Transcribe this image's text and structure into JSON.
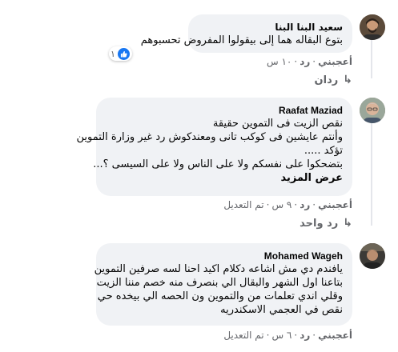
{
  "comments": [
    {
      "author": "سعيد البنا البنا",
      "lines": [
        "بتوع البقاله هما إلى بيقولوا المفروض تحسبوهم"
      ],
      "reaction_count": "١",
      "like": "أعجبني",
      "reply": "رد",
      "time": "١٠ س",
      "edited": "",
      "replies_link": "ردان"
    },
    {
      "author": "Raafat Maziad",
      "lines": [
        "نقص الزيت فى التموين حقيقة",
        "وأنتم عايشين فى كوكب تانى ومعندكوش رد غير وزارة التموين",
        "تؤكد .....",
        "بتضحكوا على نفسكم ولا على الناس ولا على السيسى ؟..."
      ],
      "see_more": "عرض المزيد",
      "like": "أعجبني",
      "reply": "رد",
      "time": "٩ س",
      "edited": "تم التعديل",
      "replies_link": "رد واحد"
    },
    {
      "author": "Mohamed Wageh",
      "lines": [
        "يافندم دي مش اشاعه دكلام اكيد احنا لسه صرفين التموين",
        "بتاعنا اول الشهر والبقال الي بنصرف منه خصم مننا الزيت",
        "وقلي اندي تعلمات من والتموين ون الحصه الي بيخده حي",
        "نقص في العجمي الاسكندريه"
      ],
      "like": "أعجبني",
      "reply": "رد",
      "time": "٦ س",
      "edited": "تم التعديل",
      "replies_link": ""
    }
  ],
  "colors": {
    "bubble": "#f0f2f5",
    "meta": "#65676b",
    "like_blue": "#1877f2"
  }
}
